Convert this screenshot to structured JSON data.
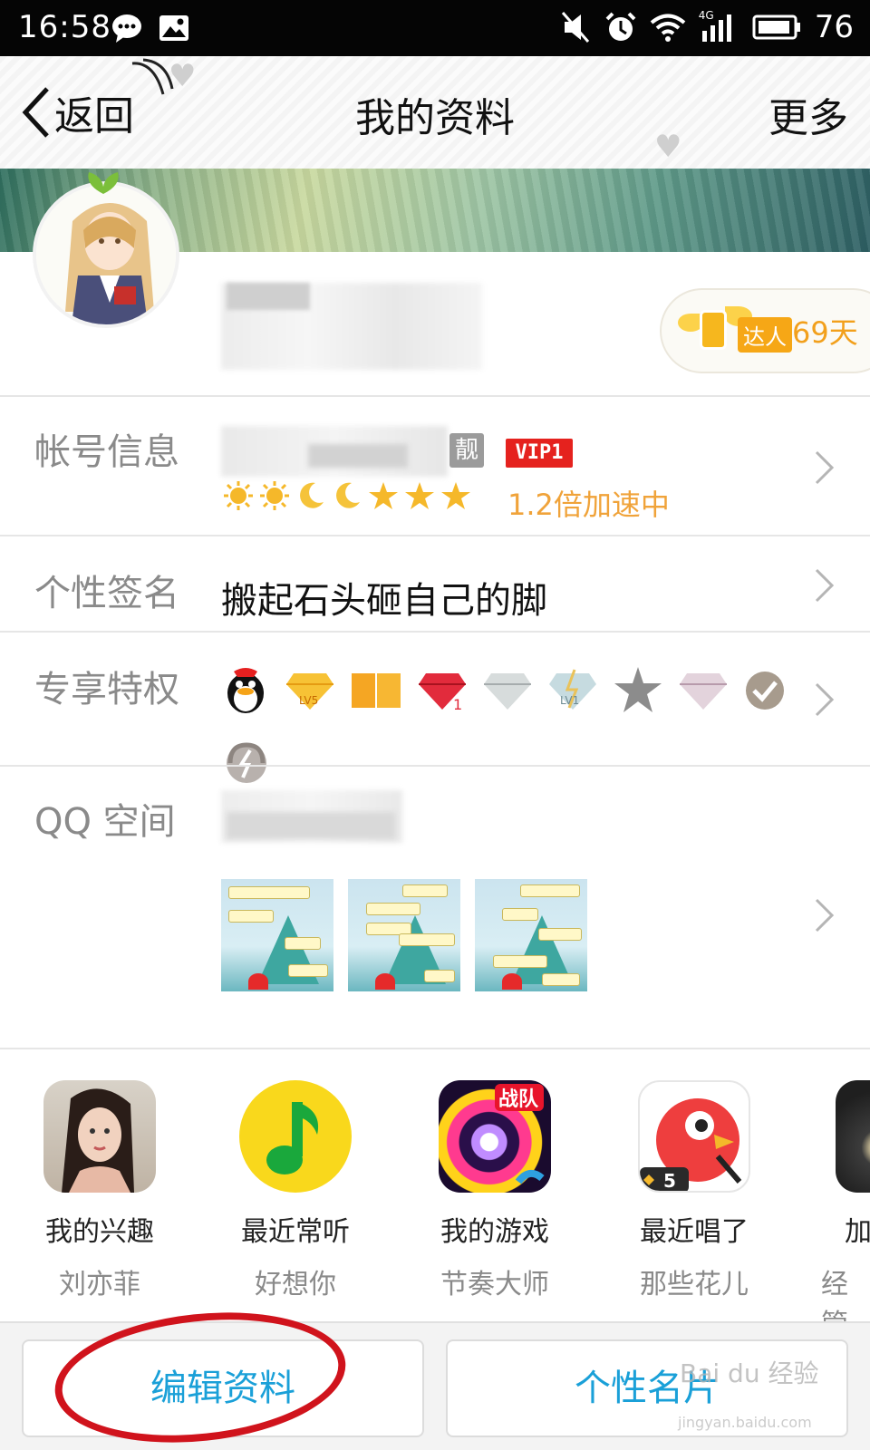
{
  "status_bar": {
    "time": "16:58",
    "battery": "76",
    "network": "4G"
  },
  "header": {
    "back_label": "返回",
    "title": "我的资料",
    "more_label": "更多"
  },
  "profile": {
    "expert_badge": "达人",
    "expert_days": "69天"
  },
  "account_info": {
    "label": "帐号信息",
    "liang_badge": "靓",
    "vip_badge": "VIP1",
    "speed_text": "1.2倍加速中"
  },
  "signature": {
    "label": "个性签名",
    "value": "搬起石头砸自己的脚"
  },
  "privileges": {
    "label": "专享特权",
    "icons": [
      "qq-penguin-icon",
      "yellow-diamond-lv5-icon",
      "orange-book-icon",
      "red-diamond-icon",
      "silver-diamond-icon",
      "blue-diamond-lv1-icon",
      "gray-star-icon",
      "pink-diamond-icon",
      "check-badge-icon",
      "speed-headphones-icon"
    ]
  },
  "qzone": {
    "label": "QQ 空间"
  },
  "apps": [
    {
      "title": "我的兴趣",
      "subtitle": "刘亦菲",
      "icon": "photo-portrait-icon"
    },
    {
      "title": "最近常听",
      "subtitle": "好想你",
      "icon": "qq-music-icon"
    },
    {
      "title": "我的游戏",
      "subtitle": "节奏大师",
      "icon": "rhythm-master-icon",
      "badge": "战队"
    },
    {
      "title": "最近唱了",
      "subtitle": "那些花儿",
      "icon": "karaoke-bird-icon",
      "badge": "5"
    },
    {
      "title": "加",
      "subtitle": "经管",
      "icon": "partial-app-icon"
    }
  ],
  "actions": {
    "edit_label": "编辑资料",
    "card_label": "个性名片"
  },
  "watermark": {
    "brand": "Bai du 经验",
    "url": "jingyan.baidu.com"
  },
  "colors": {
    "accent_blue": "#1aa0d8",
    "vip_red": "#e5221e",
    "gold": "#f0a33a",
    "annotation_red": "#d0131c"
  }
}
